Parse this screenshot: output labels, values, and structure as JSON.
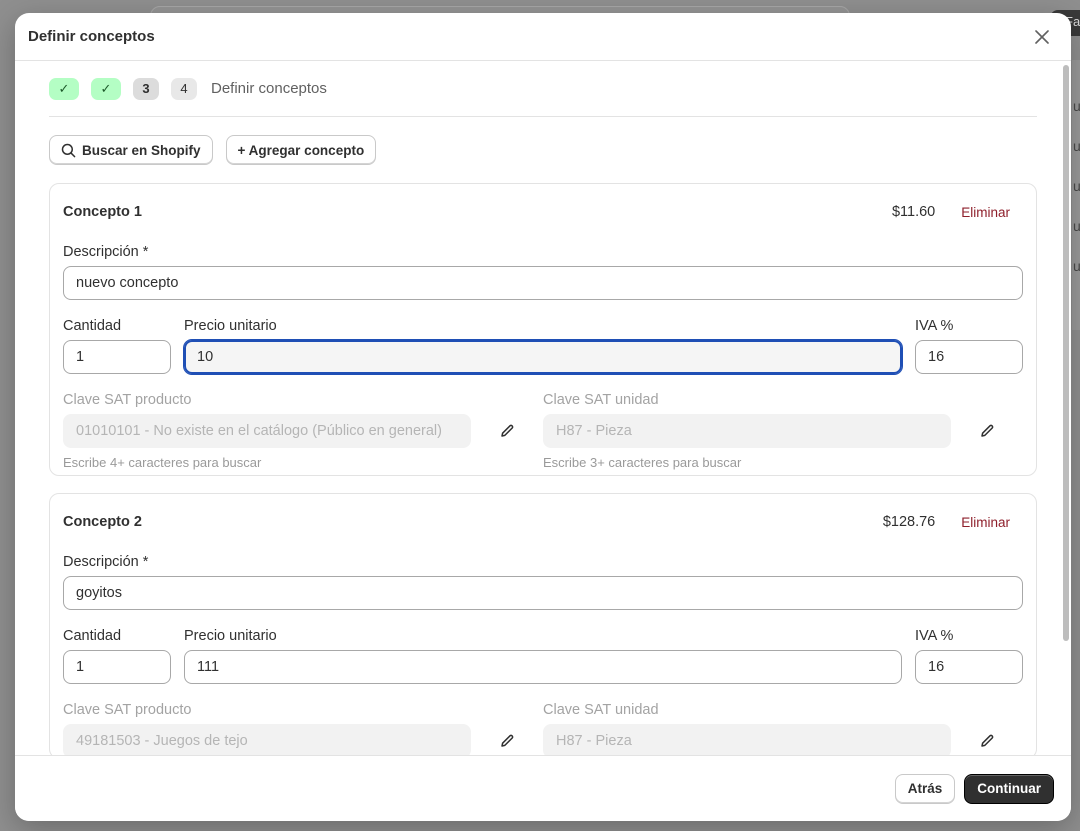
{
  "background": {
    "right_peek": [
      "u",
      "u",
      "u",
      "u",
      "u"
    ],
    "corner_text": "Fa"
  },
  "modal": {
    "title": "Definir conceptos",
    "close_icon": "close-icon"
  },
  "stepper": {
    "steps": [
      {
        "state": "done",
        "icon": "check-icon",
        "label": "✓"
      },
      {
        "state": "done",
        "icon": "check-icon",
        "label": "✓"
      },
      {
        "state": "active",
        "label": "3"
      },
      {
        "state": "pending",
        "label": "4"
      }
    ],
    "current_label": "Definir conceptos"
  },
  "actions": {
    "search_shopify": {
      "icon": "search-icon",
      "label": "Buscar en Shopify"
    },
    "add_concept": {
      "label": "+ Agregar concepto"
    }
  },
  "labels": {
    "description": "Descripción *",
    "quantity": "Cantidad",
    "unit_price": "Precio unitario",
    "iva": "IVA %",
    "sat_product": "Clave SAT producto",
    "sat_unit": "Clave SAT unidad",
    "delete": "Eliminar",
    "help_product": "Escribe 4+ caracteres para buscar",
    "help_unit": "Escribe 3+ caracteres para buscar"
  },
  "concepts": [
    {
      "title": "Concepto 1",
      "total": "$11.60",
      "description": "nuevo concepto",
      "quantity": "1",
      "unit_price": "10",
      "iva": "16",
      "sat_product": "01010101 - No existe en el catálogo (Público en general)",
      "sat_unit": "H87 - Pieza"
    },
    {
      "title": "Concepto 2",
      "total": "$128.76",
      "description": "goyitos",
      "quantity": "1",
      "unit_price": "111",
      "iva": "16",
      "sat_product": "49181503 - Juegos de tejo",
      "sat_unit": "H87 - Pieza"
    }
  ],
  "footer": {
    "back": "Atrás",
    "continue": "Continuar"
  },
  "colors": {
    "primary": "#303030",
    "focus": "#1f4fb5",
    "step_done": "#b4fec4",
    "delete": "#8e1f2b"
  }
}
